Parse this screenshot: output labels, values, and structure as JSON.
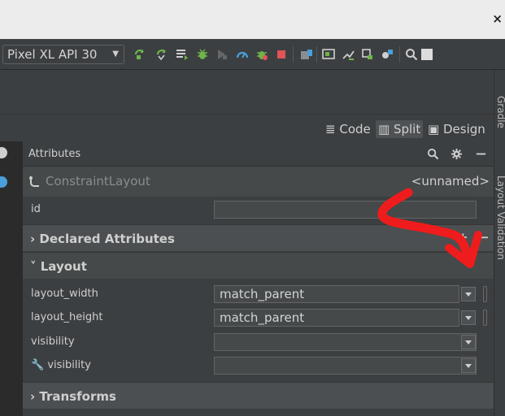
{
  "window": {
    "close_label": "×"
  },
  "toolbar": {
    "device": "Pixel XL API 30"
  },
  "mode_bar": {
    "code_label": "Code",
    "split_label": "Split",
    "design_label": "Design"
  },
  "attributes": {
    "title": "Attributes",
    "component_name": "ConstraintLayout",
    "component_id": "<unnamed>",
    "id_label": "id",
    "id_value": "",
    "sections": {
      "declared": "Declared Attributes",
      "layout": "Layout",
      "transforms": "Transforms"
    },
    "layout_rows": [
      {
        "label": "layout_width",
        "value": "match_parent"
      },
      {
        "label": "layout_height",
        "value": "match_parent"
      },
      {
        "label": "visibility",
        "value": ""
      },
      {
        "label": "visibility",
        "value": ""
      }
    ]
  },
  "sidebar": {
    "tab1": "Gradle",
    "tab2": "Layout Validation"
  },
  "colors": {
    "accent_green": "#6fb44a",
    "accent_red": "#e05555",
    "annotation_red": "#ee1c1c",
    "panel_bg": "#3c3f41"
  }
}
